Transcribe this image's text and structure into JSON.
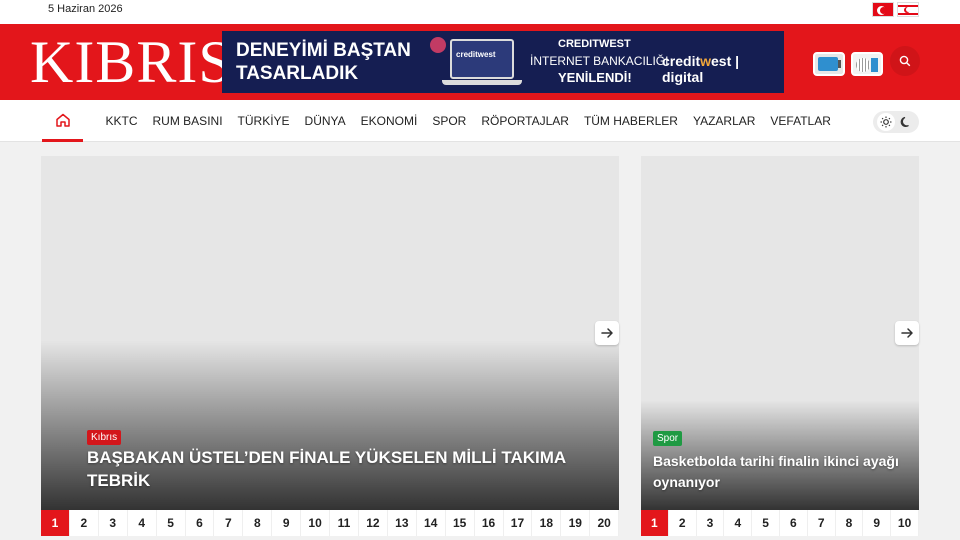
{
  "topbar": {
    "date": "5 Haziran 2026"
  },
  "header": {
    "logo": "KIBRIS",
    "banner": {
      "headline_line1": "DENEYİMİ BAŞTAN",
      "headline_line2": "TASARLADIK",
      "laptop_text": "creditwest",
      "right_line1": "CREDITWEST",
      "right_line2": "İNTERNET BANKACILIĞI",
      "right_line3": "YENİLENDİ!",
      "brand_a": "credit",
      "brand_w": "w",
      "brand_b": "est | digital"
    }
  },
  "nav": {
    "items": [
      "KKTC",
      "RUM BASINI",
      "TÜRKİYE",
      "DÜNYA",
      "EKONOMİ",
      "SPOR",
      "RÖPORTAJLAR",
      "TÜM HABERLER",
      "YAZARLAR",
      "VEFATLAR"
    ]
  },
  "main_slider": {
    "category": "Kıbrıs",
    "headline": "BAŞBAKAN ÜSTEL’DEN FİNALE YÜKSELEN MİLLİ TAKIMA TEBRİK",
    "pages": [
      "1",
      "2",
      "3",
      "4",
      "5",
      "6",
      "7",
      "8",
      "9",
      "10",
      "11",
      "12",
      "13",
      "14",
      "15",
      "16",
      "17",
      "18",
      "19",
      "20"
    ],
    "active_page": "1"
  },
  "side_slider": {
    "category": "Spor",
    "headline": "Basketbolda tarihi finalin ikinci ayağı oynanıyor",
    "pages": [
      "1",
      "2",
      "3",
      "4",
      "5",
      "6",
      "7",
      "8",
      "9",
      "10"
    ],
    "active_page": "1"
  },
  "colors": {
    "brand_red": "#e3161b",
    "banner_navy": "#151e52",
    "sport_green": "#1f9a43"
  }
}
